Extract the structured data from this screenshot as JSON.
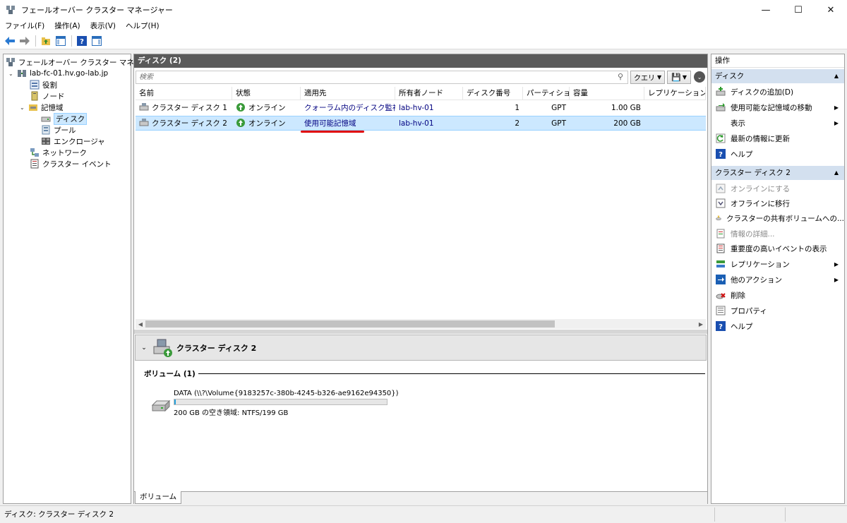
{
  "window": {
    "title": "フェールオーバー クラスター マネージャー",
    "minimize_icon": "minimize-icon",
    "maximize_icon": "maximize-icon",
    "close_icon": "close-icon"
  },
  "menu": [
    "ファイル(F)",
    "操作(A)",
    "表示(V)",
    "ヘルプ(H)"
  ],
  "toolbar": [
    "back-arrow-icon",
    "forward-arrow-icon",
    "folder-up-icon",
    "show-hide-tree-icon",
    "help-icon",
    "show-hide-action-pane-icon"
  ],
  "tree": {
    "root": "フェールオーバー クラスター マネージャー",
    "cluster": "lab-fc-01.hv.go-lab.jp",
    "roles": "役割",
    "nodes": "ノード",
    "storage": "記憶域",
    "disks": "ディスク",
    "pools": "プール",
    "enclosures": "エンクロージャ",
    "networks": "ネットワーク",
    "events": "クラスター イベント"
  },
  "center": {
    "header": "ディスク (2)",
    "search_placeholder": "検索",
    "query_label": "クエリ",
    "columns": [
      "名前",
      "状態",
      "適用先",
      "所有者ノード",
      "ディスク番号",
      "パーティショ…",
      "容量",
      "レプリケーションの…"
    ],
    "rows": [
      {
        "name": "クラスター ディスク 1",
        "status": "オンライン",
        "assigned": "クォーラム内のディスク監視",
        "owner": "lab-hv-01",
        "disk_no": "1",
        "partition": "GPT",
        "capacity": "1.00 GB",
        "replication": ""
      },
      {
        "name": "クラスター ディスク 2",
        "status": "オンライン",
        "assigned": "使用可能記憶域",
        "owner": "lab-hv-01",
        "disk_no": "2",
        "partition": "GPT",
        "capacity": "200 GB",
        "replication": ""
      }
    ],
    "selected_row": 1,
    "detail": {
      "title": "クラスター ディスク 2",
      "volumes_label": "ボリューム (1)",
      "volume_name": "DATA (\\\\?\\Volume{9183257c-380b-4245-b326-ae9162e94350})",
      "volume_free": "200 GB の空き領域: NTFS/199 GB",
      "volume_used_fraction": 0.005
    },
    "bottom_tab": "ボリューム"
  },
  "actions": {
    "title": "操作",
    "group1": "ディスク",
    "group1_items": [
      {
        "label": "ディスクの追加(D)",
        "icon": "add-disk-icon",
        "submenu": false,
        "disabled": false
      },
      {
        "label": "使用可能な記憶域の移動",
        "icon": "move-storage-icon",
        "submenu": true,
        "disabled": false
      },
      {
        "label": "表示",
        "icon": "",
        "submenu": true,
        "disabled": false
      },
      {
        "label": "最新の情報に更新",
        "icon": "refresh-icon",
        "submenu": false,
        "disabled": false
      },
      {
        "label": "ヘルプ",
        "icon": "help-icon",
        "submenu": false,
        "disabled": false
      }
    ],
    "group2": "クラスター ディスク 2",
    "group2_items": [
      {
        "label": "オンラインにする",
        "icon": "bring-online-icon",
        "submenu": false,
        "disabled": true
      },
      {
        "label": "オフラインに移行",
        "icon": "take-offline-icon",
        "submenu": false,
        "disabled": false
      },
      {
        "label": "クラスターの共有ボリュームへの...",
        "icon": "csv-add-icon",
        "submenu": false,
        "disabled": false
      },
      {
        "label": "情報の詳細...",
        "icon": "info-details-icon",
        "submenu": false,
        "disabled": true
      },
      {
        "label": "重要度の高いイベントの表示",
        "icon": "critical-events-icon",
        "submenu": false,
        "disabled": false
      },
      {
        "label": "レプリケーション",
        "icon": "replication-icon",
        "submenu": true,
        "disabled": false
      },
      {
        "label": "他のアクション",
        "icon": "more-actions-icon",
        "submenu": true,
        "disabled": false
      },
      {
        "label": "削除",
        "icon": "delete-icon",
        "submenu": false,
        "disabled": false
      },
      {
        "label": "プロパティ",
        "icon": "properties-icon",
        "submenu": false,
        "disabled": false
      },
      {
        "label": "ヘルプ",
        "icon": "help-icon",
        "submenu": false,
        "disabled": false
      }
    ]
  },
  "status_bar": "ディスク:  クラスター ディスク 2",
  "colors": {
    "selection": "#cce8ff",
    "header_dark": "#5a5a5a",
    "action_group": "#d3e0ef",
    "annotation_red": "#e00000",
    "link_blue": "#000080"
  }
}
